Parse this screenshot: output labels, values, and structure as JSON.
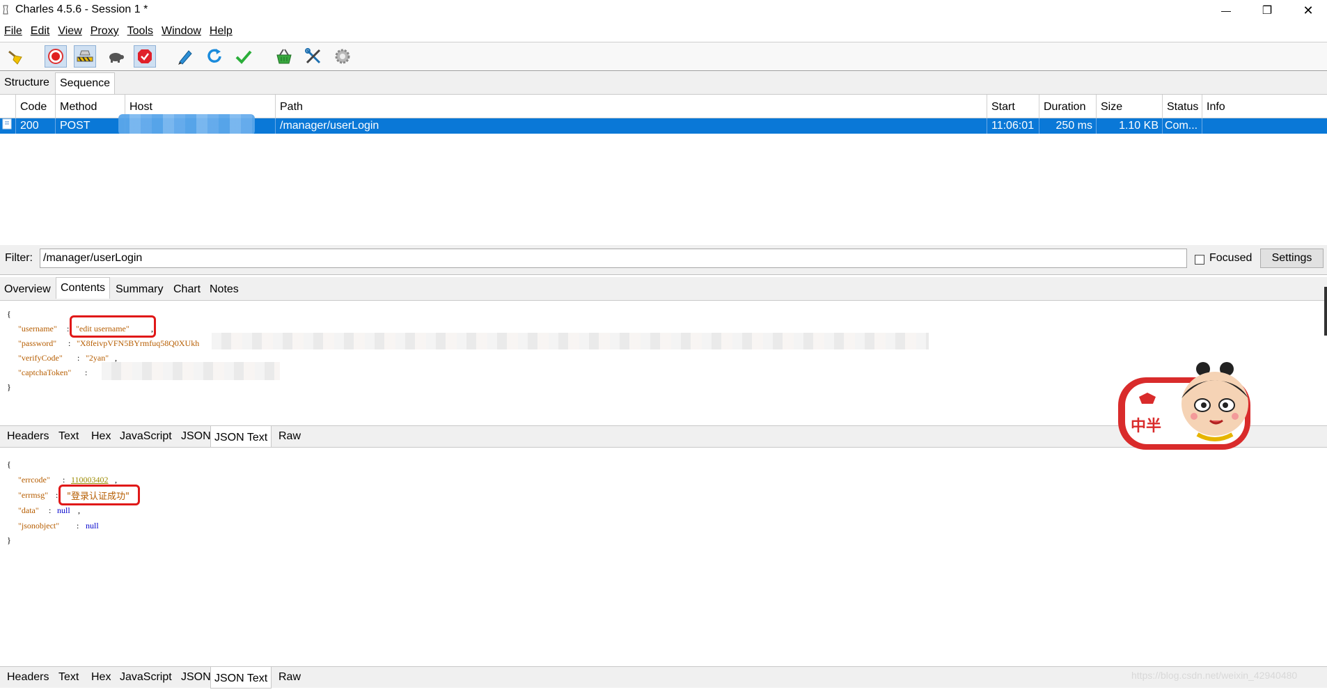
{
  "window": {
    "title": "Charles 4.5.6 - Session 1 *",
    "minimize_glyph": "—",
    "restore_glyph": "❐",
    "close_glyph": "✕"
  },
  "menu": {
    "file": "File",
    "edit": "Edit",
    "view": "View",
    "proxy": "Proxy",
    "tools": "Tools",
    "window": "Window",
    "help": "Help"
  },
  "toolbar_icons": [
    "broom-icon",
    "record-icon",
    "throttle-icon",
    "turtle-icon",
    "breakpoint-icon",
    "compose-pen-icon",
    "repeat-icon",
    "validate-check-icon",
    "basket-icon",
    "tools-icon",
    "settings-gear-icon"
  ],
  "view_tabs": {
    "structure": "Structure",
    "sequence": "Sequence"
  },
  "table": {
    "headers": {
      "code": "Code",
      "method": "Method",
      "host": "Host",
      "path": "Path",
      "start": "Start",
      "duration": "Duration",
      "size": "Size",
      "status": "Status",
      "info": "Info"
    },
    "row": {
      "code": "200",
      "method": "POST",
      "host": "",
      "path": "/manager/userLogin",
      "start": "11:06:01",
      "duration": "250 ms",
      "size": "1.10 KB",
      "status": "Com...",
      "info": ""
    }
  },
  "filter": {
    "label": "Filter:",
    "value": "/manager/userLogin",
    "focused_label": "Focused",
    "settings_label": "Settings"
  },
  "detail_tabs": {
    "overview": "Overview",
    "contents": "Contents",
    "summary": "Summary",
    "chart": "Chart",
    "notes": "Notes"
  },
  "request_body": {
    "open": "{",
    "username_key": "\"username\"",
    "username_value": "\"edit username\"",
    "password_key": "\"password\"",
    "password_value": "\"X8feivpVFN5BYrmfuq58Q0XUkh",
    "verifycode_key": "\"verifyCode\"",
    "verifycode_value": "\"2yan\"",
    "captcha_key": "\"captchaToken\"",
    "close": "}"
  },
  "sub_tabs": {
    "headers": "Headers",
    "text": "Text",
    "hex": "Hex",
    "javascript": "JavaScript",
    "json": "JSON",
    "json_text": "JSON Text",
    "raw": "Raw"
  },
  "response_body": {
    "open": "{",
    "errcode_key": "\"errcode\"",
    "errcode_value": "110003402",
    "errmsg_key": "\"errmsg\"",
    "errmsg_value": "\"登录认证成功\"",
    "data_key": "\"data\"",
    "data_value": "null",
    "jsonobject_key": "\"jsonobject\"",
    "jsonobject_value": "null",
    "close": "}"
  },
  "sticker": {
    "text": "中半"
  },
  "watermark": "https://blog.csdn.net/weixin_42940480",
  "colors": {
    "selection": "#0a78d7",
    "highlight_box": "#e01818",
    "json_key": "#b65d00",
    "json_null": "#0000cc"
  }
}
